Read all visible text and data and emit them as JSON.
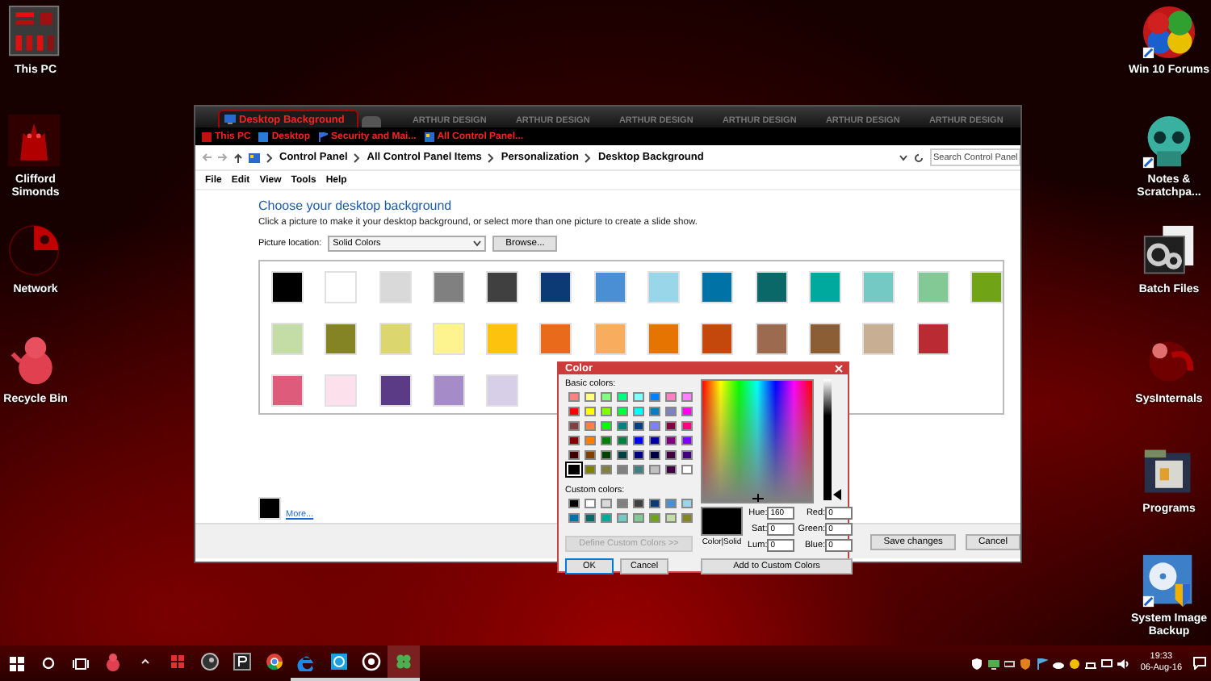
{
  "desktop_left": [
    {
      "label": "This PC"
    },
    {
      "label": "Clifford Simonds"
    },
    {
      "label": "Network"
    },
    {
      "label": "Recycle Bin"
    }
  ],
  "desktop_right": [
    {
      "label": "Win 10 Forums"
    },
    {
      "label": "Notes & Scratchpa..."
    },
    {
      "label": "Batch Files"
    },
    {
      "label": "SysInternals"
    },
    {
      "label": "Programs"
    },
    {
      "label": "System Image Backup"
    }
  ],
  "window": {
    "tab": "Desktop Background",
    "tab_decorations": [
      "ARTHUR DESIGN",
      "ARTHUR DESIGN",
      "ARTHUR DESIGN",
      "ARTHUR DESIGN",
      "ARTHUR DESIGN",
      "ARTHUR DESIGN"
    ],
    "favorites": [
      "This PC",
      "Desktop",
      "Security and Mai...",
      "All Control Panel..."
    ],
    "breadcrumb": [
      "Control Panel",
      "All Control Panel Items",
      "Personalization",
      "Desktop Background"
    ],
    "search": {
      "placeholder": "Search Control Panel"
    },
    "menu": [
      "File",
      "Edit",
      "View",
      "Tools",
      "Help"
    ],
    "heading": "Choose your desktop background",
    "description": "Click a picture to make it your desktop background, or select more than one picture to create a slide show.",
    "picture_location": {
      "label": "Picture location:",
      "value": "Solid Colors"
    },
    "browse_button": "Browse...",
    "swatch_rows": [
      [
        {
          "color": "#000000",
          "selected": false
        },
        {
          "color": "#ffffff",
          "selected": false
        },
        {
          "color": "#d9d9d9",
          "selected": false
        },
        {
          "color": "#808080",
          "selected": false
        },
        {
          "color": "#404040",
          "selected": false
        },
        {
          "color": "#0b3a74",
          "selected": false
        },
        {
          "color": "#4a8fd3",
          "selected": false
        },
        {
          "color": "#9ad6ea",
          "selected": false
        },
        {
          "color": "#0072a6",
          "selected": false
        },
        {
          "color": "#0b6868",
          "selected": false
        },
        {
          "color": "#00a99d",
          "selected": false
        },
        {
          "color": "#75c9c5",
          "selected": false
        },
        {
          "color": "#83c995",
          "selected": false
        },
        {
          "color": "#70a416",
          "selected": false
        }
      ],
      [
        {
          "color": "#c4dda6",
          "selected": false
        },
        {
          "color": "#848424",
          "selected": false
        },
        {
          "color": "#dbd66e",
          "selected": false
        },
        {
          "color": "#fdf38f",
          "selected": false
        },
        {
          "color": "#fcc20e",
          "selected": false
        },
        {
          "color": "#ea6a1c",
          "selected": false
        },
        {
          "color": "#f8ac5e",
          "selected": false
        },
        {
          "color": "#e67400",
          "selected": false
        },
        {
          "color": "#c4480c",
          "selected": false
        },
        {
          "color": "#9c6b4f",
          "selected": false
        },
        {
          "color": "#8b5e35",
          "selected": false
        },
        {
          "color": "#c8ae92",
          "selected": false
        },
        {
          "color": "#b92a33",
          "selected": false
        }
      ],
      [
        {
          "color": "#df5b7b",
          "selected": false
        },
        {
          "color": "#fce0ec",
          "selected": false
        },
        {
          "color": "#5b3b85",
          "selected": false
        },
        {
          "color": "#a58bc7",
          "selected": false
        },
        {
          "color": "#d7cee8",
          "selected": false
        }
      ]
    ],
    "current": {
      "color": "#000000",
      "link": "More..."
    },
    "buttons": [
      "Save changes",
      "Cancel"
    ]
  },
  "color_dialog": {
    "title": "Color",
    "basic_label": "Basic colors:",
    "basic_colors": [
      {
        "color": "#ff8080",
        "selected": false
      },
      {
        "color": "#ffff80",
        "selected": false
      },
      {
        "color": "#80ff80",
        "selected": false
      },
      {
        "color": "#00ff80",
        "selected": false
      },
      {
        "color": "#80ffff",
        "selected": false
      },
      {
        "color": "#0080ff",
        "selected": false
      },
      {
        "color": "#ff80c0",
        "selected": false
      },
      {
        "color": "#ff80ff",
        "selected": false
      },
      {
        "color": "#ff0000",
        "selected": false
      },
      {
        "color": "#ffff00",
        "selected": false
      },
      {
        "color": "#80ff00",
        "selected": false
      },
      {
        "color": "#00ff40",
        "selected": false
      },
      {
        "color": "#00ffff",
        "selected": false
      },
      {
        "color": "#0080c0",
        "selected": false
      },
      {
        "color": "#8080c0",
        "selected": false
      },
      {
        "color": "#ff00ff",
        "selected": false
      },
      {
        "color": "#804040",
        "selected": false
      },
      {
        "color": "#ff8040",
        "selected": false
      },
      {
        "color": "#00ff00",
        "selected": false
      },
      {
        "color": "#008080",
        "selected": false
      },
      {
        "color": "#004080",
        "selected": false
      },
      {
        "color": "#8080ff",
        "selected": false
      },
      {
        "color": "#800040",
        "selected": false
      },
      {
        "color": "#ff0080",
        "selected": false
      },
      {
        "color": "#800000",
        "selected": false
      },
      {
        "color": "#ff8000",
        "selected": false
      },
      {
        "color": "#008000",
        "selected": false
      },
      {
        "color": "#008040",
        "selected": false
      },
      {
        "color": "#0000ff",
        "selected": false
      },
      {
        "color": "#0000a0",
        "selected": false
      },
      {
        "color": "#800080",
        "selected": false
      },
      {
        "color": "#8000ff",
        "selected": false
      },
      {
        "color": "#400000",
        "selected": false
      },
      {
        "color": "#804000",
        "selected": false
      },
      {
        "color": "#004000",
        "selected": false
      },
      {
        "color": "#004040",
        "selected": false
      },
      {
        "color": "#000080",
        "selected": false
      },
      {
        "color": "#000040",
        "selected": false
      },
      {
        "color": "#400040",
        "selected": false
      },
      {
        "color": "#400080",
        "selected": false
      },
      {
        "color": "#000000",
        "selected": true
      },
      {
        "color": "#808000",
        "selected": false
      },
      {
        "color": "#808040",
        "selected": false
      },
      {
        "color": "#808080",
        "selected": false
      },
      {
        "color": "#408080",
        "selected": false
      },
      {
        "color": "#c0c0c0",
        "selected": false
      },
      {
        "color": "#400040",
        "selected": false
      },
      {
        "color": "#ffffff",
        "selected": false
      }
    ],
    "custom_label": "Custom colors:",
    "custom_colors": [
      {
        "color": "#000000",
        "selected": false
      },
      {
        "color": "#ffffff",
        "selected": false
      },
      {
        "color": "#d9d9d9",
        "selected": false
      },
      {
        "color": "#808080",
        "selected": false
      },
      {
        "color": "#404040",
        "selected": false
      },
      {
        "color": "#0b3a74",
        "selected": false
      },
      {
        "color": "#4a8fd3",
        "selected": false
      },
      {
        "color": "#9ad6ea",
        "selected": false
      },
      {
        "color": "#0072a6",
        "selected": false
      },
      {
        "color": "#0b6868",
        "selected": false
      },
      {
        "color": "#00a99d",
        "selected": false
      },
      {
        "color": "#75c9c5",
        "selected": false
      },
      {
        "color": "#83c995",
        "selected": false
      },
      {
        "color": "#70a416",
        "selected": false
      },
      {
        "color": "#c4dda6",
        "selected": false
      },
      {
        "color": "#848424",
        "selected": false
      }
    ],
    "define_button": {
      "label": "Define Custom Colors >>",
      "disabled": true
    },
    "ok_button": {
      "label": "OK",
      "focused": true
    },
    "cancel_button": {
      "label": "Cancel",
      "focused": false
    },
    "luminance": {
      "level": 0
    },
    "preview": {
      "color": "#000000",
      "label": "Color|Solid"
    },
    "fields": [
      {
        "label": "Hue:",
        "value": "160"
      },
      {
        "label": "Red:",
        "value": "0"
      },
      {
        "label": "Sat:",
        "value": "0"
      },
      {
        "label": "Green:",
        "value": "0"
      },
      {
        "label": "Lum:",
        "value": "0"
      },
      {
        "label": "Blue:",
        "value": "0"
      }
    ],
    "add_button": "Add to Custom Colors"
  },
  "taskbar": {
    "apps": [
      {
        "running": false,
        "selected": false
      },
      {
        "running": false,
        "selected": false
      },
      {
        "running": false,
        "selected": false
      },
      {
        "running": false,
        "selected": false
      },
      {
        "running": false,
        "selected": false
      },
      {
        "running": false,
        "selected": false
      },
      {
        "running": true,
        "selected": false
      },
      {
        "running": true,
        "selected": false
      },
      {
        "running": true,
        "selected": false
      },
      {
        "running": true,
        "selected": true
      }
    ],
    "time": "19:33",
    "date": "06-Aug-16"
  }
}
